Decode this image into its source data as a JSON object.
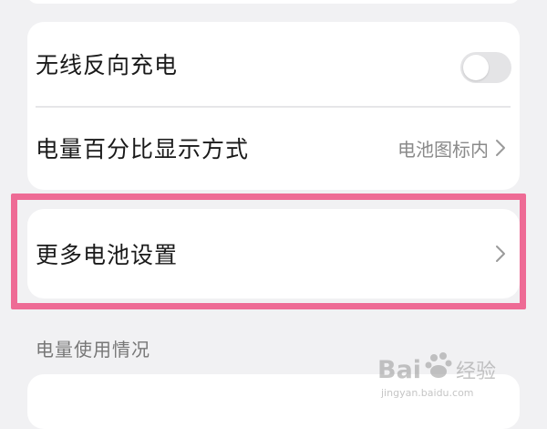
{
  "settings_card": {
    "wireless_reverse_charging": {
      "label": "无线反向充电",
      "enabled": false
    },
    "battery_percentage_display": {
      "label": "电量百分比显示方式",
      "value": "电池图标内"
    }
  },
  "more_card": {
    "more_battery_settings_label": "更多电池设置"
  },
  "section": {
    "battery_usage_header": "电量使用情况"
  },
  "colors": {
    "highlight_border": "#ee6b95",
    "toggle_off": "#e4e4e6",
    "background": "#f1f1f3"
  },
  "watermark": {
    "logo": "Bai百 经验",
    "url": "jingyan.baidu.com"
  }
}
